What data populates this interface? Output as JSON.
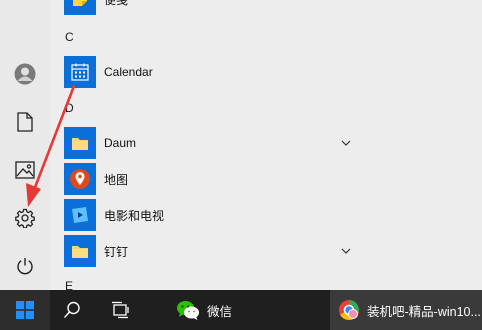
{
  "start_menu": {
    "letters": {
      "c": "C",
      "d": "D",
      "e": "E"
    },
    "apps": [
      {
        "label": "便笺",
        "icon": "sticky-notes-icon"
      },
      {
        "label": "Calendar",
        "icon": "calendar-icon"
      },
      {
        "label": "Daum",
        "icon": "folder-icon",
        "expandable": true
      },
      {
        "label": "地图",
        "icon": "maps-icon"
      },
      {
        "label": "电影和电视",
        "icon": "movies-tv-icon"
      },
      {
        "label": "钉钉",
        "icon": "folder-icon",
        "expandable": true
      }
    ]
  },
  "rail": {
    "items": [
      {
        "icon": "user-avatar-icon"
      },
      {
        "icon": "document-icon"
      },
      {
        "icon": "pictures-icon"
      },
      {
        "icon": "gear-icon"
      },
      {
        "icon": "power-icon"
      }
    ]
  },
  "taskbar": {
    "start": {
      "icon": "windows-logo-icon"
    },
    "search": {
      "icon": "search-icon"
    },
    "task_view": {
      "icon": "task-view-icon"
    },
    "wechat": {
      "label": "微信",
      "icon": "wechat-icon"
    },
    "browser": {
      "label": "装机吧-精品-win10...",
      "icon": "browser-icon"
    }
  },
  "annotation": {
    "icon": "red-arrow-annotation",
    "color": "#e53935"
  },
  "colors": {
    "accent": "#0a6fd8",
    "taskbar": "#1f1f1f",
    "rail": "#e9e9e9",
    "list": "#ededed",
    "folder": "#f7d36b"
  }
}
